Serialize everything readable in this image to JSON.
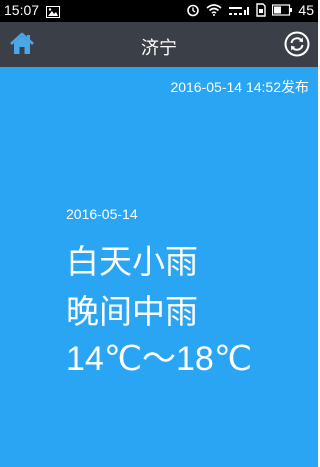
{
  "status_bar": {
    "time": "15:07",
    "battery": "45",
    "signal_text": "…ll"
  },
  "header": {
    "home_icon": "home-icon",
    "title": "济宁",
    "refresh_icon": "refresh-icon"
  },
  "weather": {
    "publish_time": "2016-05-14 14:52发布",
    "date": "2016-05-14",
    "day": "白天小雨",
    "night": "晚间中雨",
    "temperature": "14℃～18℃"
  },
  "colors": {
    "background": "#2aa5f4",
    "title_bar": "#3b3f47",
    "home_icon": "#4aa8e8"
  }
}
